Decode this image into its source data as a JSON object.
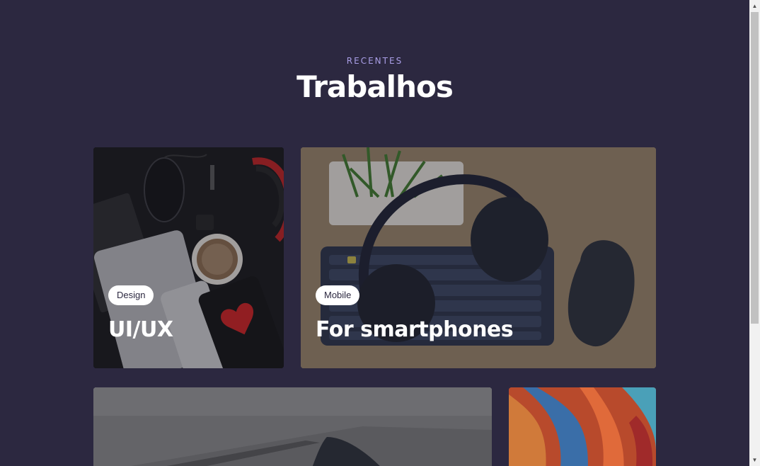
{
  "section": {
    "kicker": "RECENTES",
    "title": "Trabalhos"
  },
  "cards": [
    {
      "tag": "Design",
      "title": "UI/UX",
      "image": "desk-with-mouse-phone-coffee-photo"
    },
    {
      "tag": "Mobile",
      "title": "For smartphones",
      "image": "keyboard-headphones-mouse-photo"
    },
    {
      "tag": "",
      "title": "",
      "image": "laptop-closeup-photo"
    },
    {
      "tag": "",
      "title": "",
      "image": "colorful-abstract-wallpaper-photo"
    }
  ],
  "scrollbar": {
    "up_icon": "chevron-up-icon",
    "down_icon": "chevron-down-icon"
  }
}
